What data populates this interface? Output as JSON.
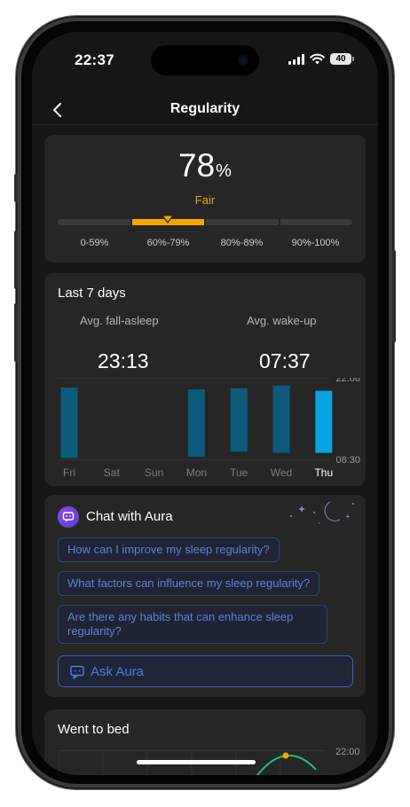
{
  "status_bar": {
    "time": "22:37",
    "battery": "40"
  },
  "nav": {
    "title": "Regularity",
    "back_icon": "chevron-left-icon"
  },
  "score": {
    "value": "78",
    "unit": "%",
    "rating": "Fair",
    "rating_color": "#f0a800",
    "ranges": [
      "0-59%",
      "60%-79%",
      "80%-89%",
      "90%-100%"
    ],
    "active_range_index": 1,
    "marker_position_percent": 78
  },
  "last7": {
    "title": "Last 7 days",
    "fall_asleep_label": "Avg. fall-asleep",
    "fall_asleep_value": "23:13",
    "wake_label": "Avg. wake-up",
    "wake_value": "07:37",
    "axis_top": "22:00",
    "axis_bottom": "08:30",
    "days": [
      "Fri",
      "Sat",
      "Sun",
      "Mon",
      "Tue",
      "Wed",
      "Thu"
    ],
    "selected_day": "Thu",
    "bar_color": "#0d5a7a",
    "selected_bar_color": "#0aa2e0"
  },
  "chart_data": {
    "type": "bar",
    "title": "",
    "xlabel": "",
    "ylabel": "",
    "categories": [
      "Fri",
      "Sat",
      "Sun",
      "Mon",
      "Tue",
      "Wed",
      "Thu"
    ],
    "ylim": [
      "22:00",
      "08:30"
    ],
    "series": [
      {
        "sleep_start": [
          "23:15",
          null,
          null,
          "23:30",
          "23:20",
          "23:00",
          "23:40"
        ],
        "sleep_end": [
          "08:20",
          null,
          null,
          "08:10",
          "07:30",
          "07:40",
          "07:40"
        ]
      }
    ]
  },
  "chat": {
    "title": "Chat with Aura",
    "suggestions": [
      "How can I improve my sleep regularity?",
      "What factors can influence my sleep regularity?",
      "Are there any habits that can enhance sleep regularity?"
    ],
    "ask_label": "Ask Aura"
  },
  "went_to_bed": {
    "title": "Went to bed",
    "axis_label": "22:00",
    "line_color": "#1fbf7a",
    "dot_color": "#f0a800"
  }
}
